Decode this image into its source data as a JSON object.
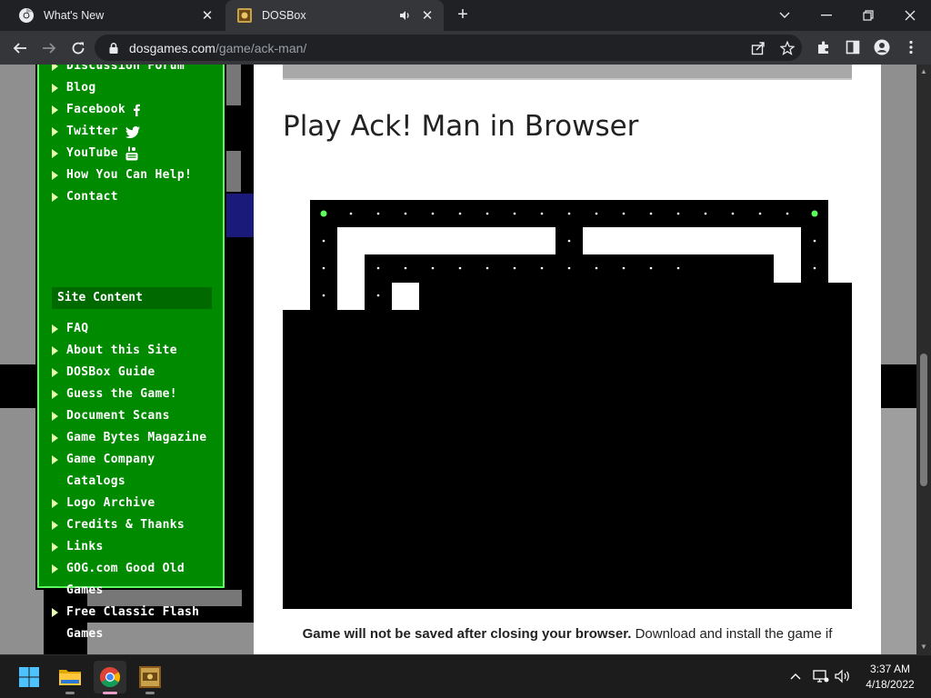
{
  "tabs": [
    {
      "title": "What's New"
    },
    {
      "title": "DOSBox"
    }
  ],
  "omnibox": {
    "host": "dosgames.com",
    "path": "/game/ack-man/"
  },
  "side_menu": {
    "items_top": [
      {
        "label": "Discussion Forum"
      },
      {
        "label": "Blog"
      },
      {
        "label": "Facebook"
      },
      {
        "label": "Twitter"
      },
      {
        "label": "YouTube"
      },
      {
        "label": "How You Can Help!"
      },
      {
        "label": "Contact"
      }
    ],
    "section_title": "Site Content",
    "items": [
      {
        "label": "FAQ"
      },
      {
        "label": "About this Site"
      },
      {
        "label": "DOSBox Guide"
      },
      {
        "label": "Guess the Game!"
      },
      {
        "label": "Document Scans"
      },
      {
        "label": "Game Bytes Magazine"
      },
      {
        "label": "Game Company",
        "cont": "Catalogs"
      },
      {
        "label": "Logo Archive"
      },
      {
        "label": "Credits & Thanks"
      },
      {
        "label": "Links"
      },
      {
        "label": "GOG.com Good Old",
        "cont": "Games"
      },
      {
        "label": "Free Classic Flash",
        "cont": "Games"
      }
    ]
  },
  "content": {
    "title": "Play Ack! Man in Browser",
    "notice_bold": "Game will not be saved after closing your browser.",
    "notice_rest": " Download and install the game if"
  },
  "taskbar": {
    "time": "3:37 AM",
    "date": "4/18/2022"
  },
  "colors": {
    "menu_green": "#008a00",
    "menu_border": "#5cff5c",
    "pellet_power": "#5cff5c"
  }
}
